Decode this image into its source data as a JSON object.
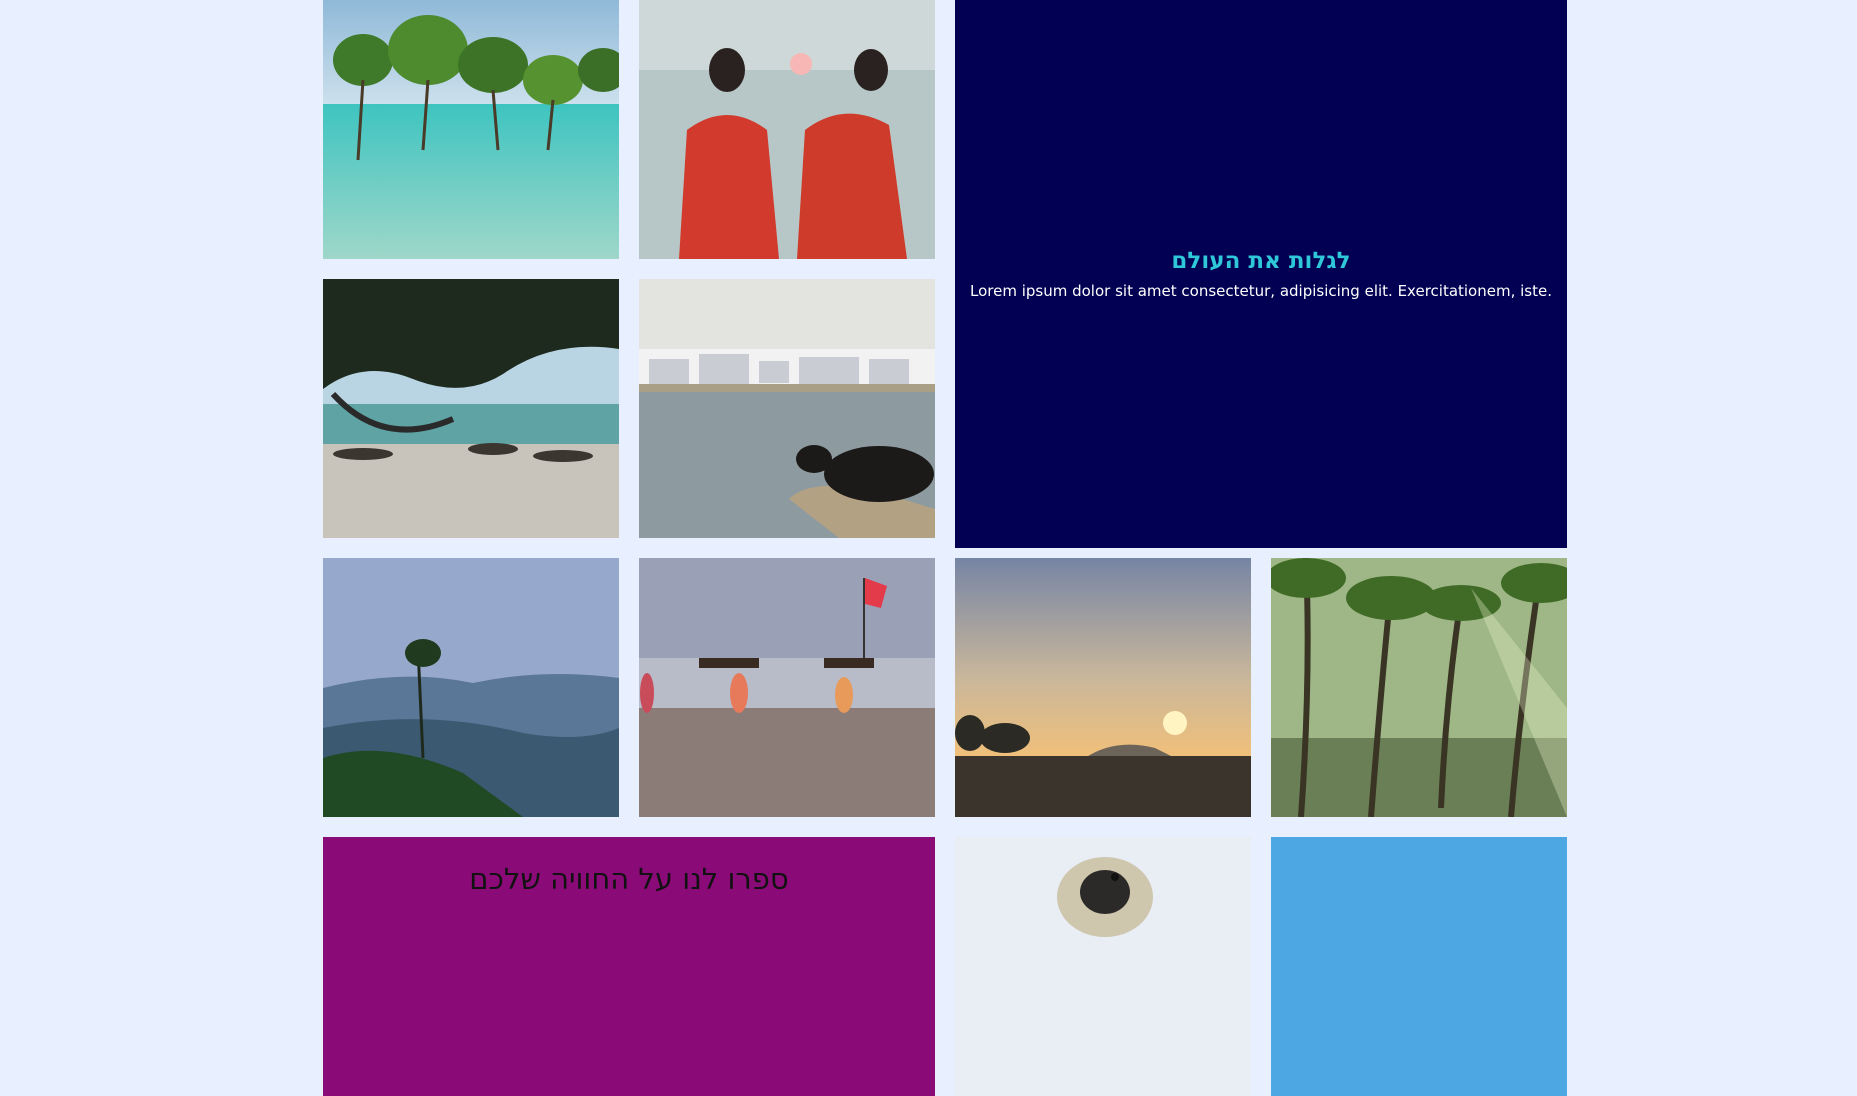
{
  "colors": {
    "page_bg": "#e8efff",
    "promo_bg": "#010052",
    "promo_title": "#2ec8d8",
    "promo_text": "#ffffff",
    "share_bg": "#8a0b78"
  },
  "promo": {
    "title": "לגלות את העולם",
    "text": "Lorem ipsum dolor sit amet consectetur, adipisicing elit. Exercitationem, iste."
  },
  "share": {
    "title": "ספרו לנו על החוויה שלכם"
  },
  "gallery": [
    {
      "name": "mangroves-photo"
    },
    {
      "name": "women-sunset-photo"
    },
    {
      "name": "hammock-beach-photo"
    },
    {
      "name": "cow-lake-photo"
    },
    {
      "name": "misty-hills-photo"
    },
    {
      "name": "beach-carriers-photo"
    },
    {
      "name": "sunset-shore-photo"
    },
    {
      "name": "palm-forest-photo"
    },
    {
      "name": "monkey-photo"
    },
    {
      "name": "blue-sky-photo"
    }
  ]
}
